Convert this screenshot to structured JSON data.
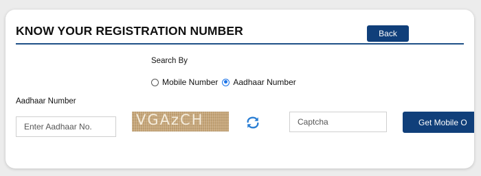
{
  "header": {
    "title": "KNOW YOUR REGISTRATION NUMBER",
    "back_label": "Back"
  },
  "search": {
    "label": "Search By",
    "options": [
      {
        "label": "Mobile Number",
        "selected": false
      },
      {
        "label": "Aadhaar Number",
        "selected": true
      }
    ]
  },
  "form": {
    "aadhaar_label": "Aadhaar Number",
    "aadhaar_placeholder": "Enter Aadhaar No.",
    "captcha_text": "VGAzCH",
    "captcha_placeholder": "Captcha",
    "submit_label": "Get Mobile O"
  },
  "icons": {
    "refresh": "refresh-icon",
    "radio": "radio-icon"
  },
  "colors": {
    "primary": "#103f7a",
    "rule": "#1d4f86",
    "radio_selected": "#1a73e8",
    "refresh": "#2b7fd4",
    "captcha_bg": "#c4a477"
  }
}
